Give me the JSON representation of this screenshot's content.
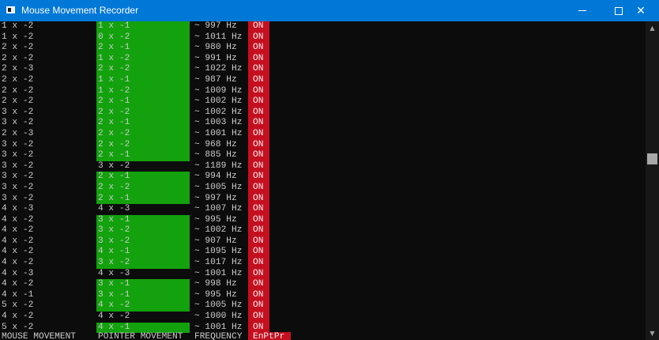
{
  "window": {
    "title": "Mouse Movement Recorder",
    "minimize_icon": "minimize-icon",
    "maximize_icon": "maximize-icon",
    "close_icon": "close-icon",
    "close_glyph": "✕"
  },
  "colors": {
    "titlebar": "#0078d7",
    "console_bg": "#0c0c0c",
    "console_text": "#cccccc",
    "pointer_highlight": "#13a10e",
    "status_bg": "#c50f1f"
  },
  "rows": [
    {
      "mouse": "1 x -2",
      "pointer": "1 x -1",
      "freq": "~ 997 Hz",
      "status": "ON",
      "highlight": true
    },
    {
      "mouse": "1 x -2",
      "pointer": "0 x -2",
      "freq": "~ 1011 Hz",
      "status": "ON",
      "highlight": true
    },
    {
      "mouse": "2 x -2",
      "pointer": "2 x -1",
      "freq": "~ 980 Hz",
      "status": "ON",
      "highlight": true
    },
    {
      "mouse": "2 x -2",
      "pointer": "1 x -2",
      "freq": "~ 991 Hz",
      "status": "ON",
      "highlight": true
    },
    {
      "mouse": "2 x -3",
      "pointer": "2 x -2",
      "freq": "~ 1022 Hz",
      "status": "ON",
      "highlight": true
    },
    {
      "mouse": "2 x -2",
      "pointer": "1 x -1",
      "freq": "~ 987 Hz",
      "status": "ON",
      "highlight": true
    },
    {
      "mouse": "2 x -2",
      "pointer": "1 x -2",
      "freq": "~ 1009 Hz",
      "status": "ON",
      "highlight": true
    },
    {
      "mouse": "2 x -2",
      "pointer": "2 x -1",
      "freq": "~ 1002 Hz",
      "status": "ON",
      "highlight": true
    },
    {
      "mouse": "3 x -2",
      "pointer": "2 x -2",
      "freq": "~ 1002 Hz",
      "status": "ON",
      "highlight": true
    },
    {
      "mouse": "3 x -2",
      "pointer": "2 x -1",
      "freq": "~ 1003 Hz",
      "status": "ON",
      "highlight": true
    },
    {
      "mouse": "2 x -3",
      "pointer": "2 x -2",
      "freq": "~ 1001 Hz",
      "status": "ON",
      "highlight": true
    },
    {
      "mouse": "3 x -2",
      "pointer": "2 x -2",
      "freq": "~ 968 Hz",
      "status": "ON",
      "highlight": true
    },
    {
      "mouse": "3 x -2",
      "pointer": "2 x -1",
      "freq": "~ 885 Hz",
      "status": "ON",
      "highlight": true
    },
    {
      "mouse": "3 x -2",
      "pointer": "3 x -2",
      "freq": "~ 1189 Hz",
      "status": "ON",
      "highlight": false
    },
    {
      "mouse": "3 x -2",
      "pointer": "2 x -1",
      "freq": "~ 994 Hz",
      "status": "ON",
      "highlight": true
    },
    {
      "mouse": "3 x -2",
      "pointer": "2 x -2",
      "freq": "~ 1005 Hz",
      "status": "ON",
      "highlight": true
    },
    {
      "mouse": "3 x -2",
      "pointer": "2 x -1",
      "freq": "~ 997 Hz",
      "status": "ON",
      "highlight": true
    },
    {
      "mouse": "4 x -3",
      "pointer": "4 x -3",
      "freq": "~ 1007 Hz",
      "status": "ON",
      "highlight": false
    },
    {
      "mouse": "4 x -2",
      "pointer": "3 x -1",
      "freq": "~ 995 Hz",
      "status": "ON",
      "highlight": true
    },
    {
      "mouse": "4 x -2",
      "pointer": "3 x -2",
      "freq": "~ 1002 Hz",
      "status": "ON",
      "highlight": true
    },
    {
      "mouse": "4 x -2",
      "pointer": "3 x -2",
      "freq": "~ 907 Hz",
      "status": "ON",
      "highlight": true
    },
    {
      "mouse": "4 x -2",
      "pointer": "4 x -1",
      "freq": "~ 1095 Hz",
      "status": "ON",
      "highlight": true
    },
    {
      "mouse": "4 x -2",
      "pointer": "3 x -2",
      "freq": "~ 1017 Hz",
      "status": "ON",
      "highlight": true
    },
    {
      "mouse": "4 x -3",
      "pointer": "4 x -3",
      "freq": "~ 1001 Hz",
      "status": "ON",
      "highlight": false
    },
    {
      "mouse": "4 x -2",
      "pointer": "3 x -1",
      "freq": "~ 998 Hz",
      "status": "ON",
      "highlight": true
    },
    {
      "mouse": "4 x -1",
      "pointer": "3 x -1",
      "freq": "~ 995 Hz",
      "status": "ON",
      "highlight": true
    },
    {
      "mouse": "5 x -2",
      "pointer": "4 x -2",
      "freq": "~ 1005 Hz",
      "status": "ON",
      "highlight": true
    },
    {
      "mouse": "4 x -2",
      "pointer": "4 x -2",
      "freq": "~ 1000 Hz",
      "status": "ON",
      "highlight": false
    },
    {
      "mouse": "5 x -2",
      "pointer": "4 x -1",
      "freq": "~ 1001 Hz",
      "status": "ON",
      "highlight": true
    }
  ],
  "header": {
    "mouse": "MOUSE MOVEMENT",
    "pointer": "POINTER MOVEMENT",
    "freq": "FREQUENCY",
    "status": "EnPtPr"
  },
  "scrollbar": {
    "up_icon": "scroll-up-arrow-icon",
    "down_icon": "scroll-down-arrow-icon",
    "up_glyph": "▲",
    "down_glyph": "▼"
  }
}
